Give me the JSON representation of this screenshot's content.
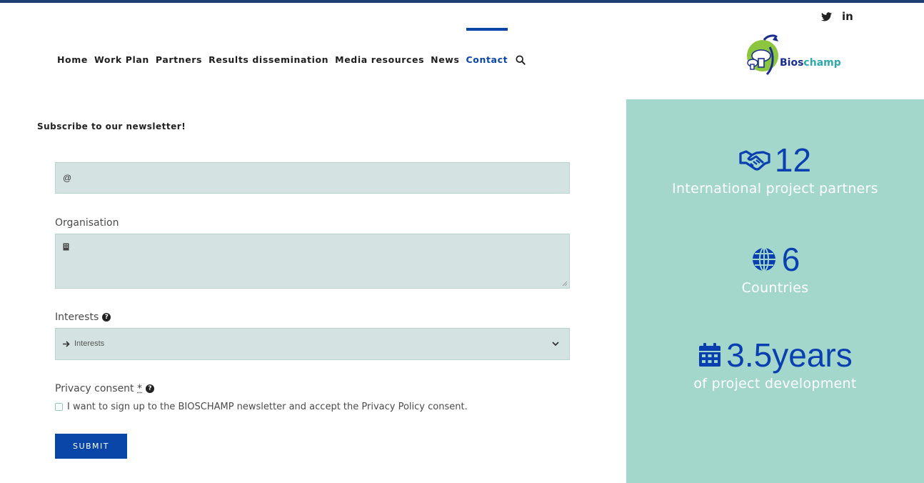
{
  "social": {
    "twitter": "🐦",
    "linkedin": "in"
  },
  "nav": {
    "items": [
      {
        "label": "Home"
      },
      {
        "label": "Work Plan"
      },
      {
        "label": "Partners"
      },
      {
        "label": "Results dissemination"
      },
      {
        "label": "Media resources"
      },
      {
        "label": "News"
      },
      {
        "label": "Contact"
      }
    ],
    "active": "Contact"
  },
  "logo": {
    "part1": "Bios",
    "part2": "champ"
  },
  "newsletter": {
    "title": "Subscribe to our newsletter!",
    "email_prefix": "@",
    "organisation_label": "Organisation",
    "interests_label": "Interests",
    "interests_selected": "Interests",
    "privacy_label": "Privacy consent",
    "privacy_required": "*",
    "consent_text": "I want to sign up to the BIOSCHAMP newsletter and accept the Privacy Policy consent.",
    "submit_label": "SUBMIT"
  },
  "stats": [
    {
      "icon": "handshake-icon",
      "value": "12",
      "label": "International project partners"
    },
    {
      "icon": "globe-icon",
      "value": "6",
      "label": "Countries"
    },
    {
      "icon": "calendar-icon",
      "value": "3.5years",
      "label": "of project development"
    }
  ],
  "colors": {
    "accent": "#0a46a8",
    "sidebar_bg": "#a3d7cc",
    "field_bg": "#d4e3e1"
  }
}
